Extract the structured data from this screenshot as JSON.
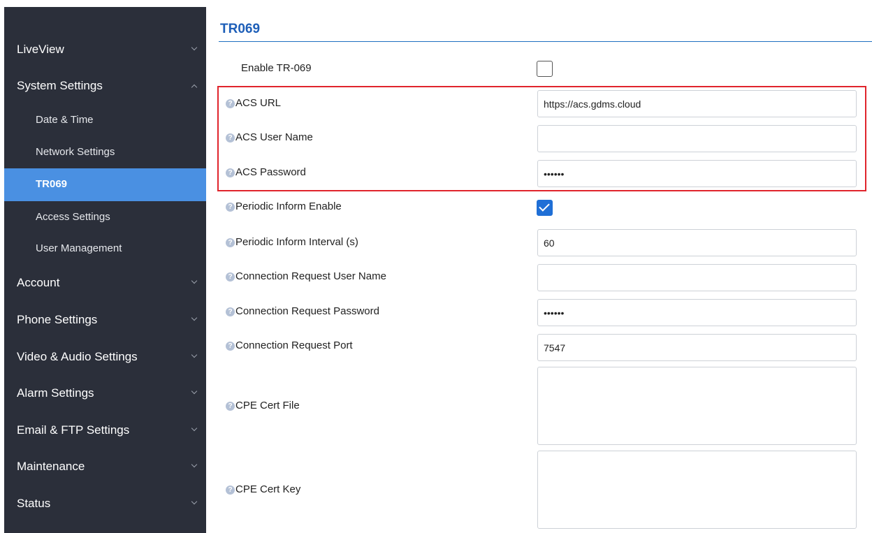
{
  "sidebar": {
    "items": [
      {
        "label": "LiveView"
      },
      {
        "label": "System Settings"
      },
      {
        "label": "Account"
      },
      {
        "label": "Phone Settings"
      },
      {
        "label": "Video & Audio Settings"
      },
      {
        "label": "Alarm Settings"
      },
      {
        "label": "Email & FTP Settings"
      },
      {
        "label": "Maintenance"
      },
      {
        "label": "Status"
      }
    ],
    "system_settings_subitems": [
      {
        "label": "Date & Time"
      },
      {
        "label": "Network Settings"
      },
      {
        "label": "TR069"
      },
      {
        "label": "Access Settings"
      },
      {
        "label": "User Management"
      }
    ],
    "active_subitem": "TR069"
  },
  "page": {
    "title": "TR069"
  },
  "form": {
    "enable_tr069": {
      "label": "Enable TR-069",
      "checked": false
    },
    "acs_url": {
      "label": "ACS URL",
      "value": "https://acs.gdms.cloud"
    },
    "acs_user_name": {
      "label": "ACS User Name",
      "value": ""
    },
    "acs_password": {
      "label": "ACS Password",
      "value": "••••••"
    },
    "periodic_inform_enable": {
      "label": "Periodic Inform Enable",
      "checked": true
    },
    "periodic_inform_interval": {
      "label": "Periodic Inform Interval (s)",
      "value": "60"
    },
    "connection_request_user_name": {
      "label": "Connection Request User Name",
      "value": ""
    },
    "connection_request_password": {
      "label": "Connection Request Password",
      "value": "••••••"
    },
    "connection_request_port": {
      "label": "Connection Request Port",
      "value": "7547"
    },
    "cpe_cert_file": {
      "label": "CPE Cert File",
      "value": ""
    },
    "cpe_cert_key": {
      "label": "CPE Cert Key",
      "value": ""
    }
  },
  "help_icon_glyph": "?",
  "colors": {
    "sidebar_bg": "#2b2f3a",
    "active_item_bg": "#4a90e2",
    "title_color": "#1e5fb8",
    "highlight_border": "#e0242c",
    "checkbox_checked": "#1f6fd6"
  }
}
